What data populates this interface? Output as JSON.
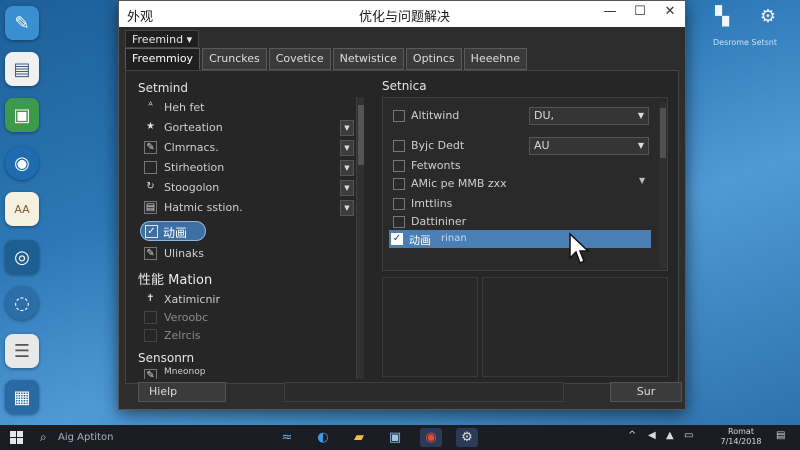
{
  "desktop": {
    "right_icon_label": "Desrome Setsnt"
  },
  "window": {
    "app_title": "外观",
    "title": "优化与问题解决",
    "controls": {
      "minimize": "—",
      "maximize": "☐",
      "close": "✕"
    },
    "profile_button": "Freemind ▾",
    "tabs": [
      {
        "label": "Freemmioy",
        "active": true
      },
      {
        "label": "Crunckes",
        "active": false
      },
      {
        "label": "Covetice",
        "active": false
      },
      {
        "label": "Netwistice",
        "active": false
      },
      {
        "label": "Optincs",
        "active": false
      },
      {
        "label": "Heeehne",
        "active": false
      }
    ]
  },
  "left_pane": {
    "section_title": "Setmind",
    "items": [
      {
        "label": "Heh fet",
        "icon": "ᴬ",
        "has_dropdown": false
      },
      {
        "label": "Gorteation",
        "icon": "★",
        "has_dropdown": true
      },
      {
        "label": "Clmrnacs.",
        "icon": "✎",
        "has_dropdown": true
      },
      {
        "label": "Stirheotion",
        "icon": "",
        "has_dropdown": true
      },
      {
        "label": "Stoogolon",
        "icon": "↻",
        "has_dropdown": true
      },
      {
        "label": "Hatmic sstion.",
        "icon": "▤",
        "has_dropdown": true
      }
    ],
    "highlight_item": {
      "label": "动画",
      "checked": true
    },
    "item_after": {
      "label": "Ulinaks",
      "icon": "✎"
    },
    "section2_title": "性能 Mation",
    "perf_items": [
      {
        "label": "Xatimicnir",
        "icon": "✝"
      },
      {
        "label": "Veroobc",
        "icon": ""
      },
      {
        "label": "Zelrcis",
        "icon": ""
      }
    ],
    "section3_title": "Sensonrn",
    "partial_item": {
      "label": "Mneonop",
      "icon": "✎"
    }
  },
  "right_pane": {
    "section_title": "Setnica",
    "rows": [
      {
        "label": "Altitwind",
        "checked": false,
        "select": "DU,",
        "arrow": "▼"
      },
      {
        "label": "Byjc Dedt",
        "checked": false,
        "select": "AU",
        "arrow": "▼"
      },
      {
        "label": "Fetwonts",
        "checked": false
      },
      {
        "label": "AMic pe MMB zxx",
        "checked": false,
        "arrow": "▼"
      },
      {
        "label": "Imttlins",
        "checked": false
      },
      {
        "label": "Dattininer",
        "checked": false
      }
    ],
    "highlight_row": {
      "label": "动画",
      "sub": "rinan",
      "checked": true
    }
  },
  "buttons": {
    "help": "Hielp",
    "ok": "Sur"
  },
  "taskbar": {
    "search_placeholder": "Aig Aptiton",
    "clock_time": "Romat",
    "clock_date": "7/14/2018"
  },
  "colors": {
    "accent": "#4a7fb5",
    "window_bg": "#2d2d2d",
    "titlebar_bg": "#ffffff"
  }
}
